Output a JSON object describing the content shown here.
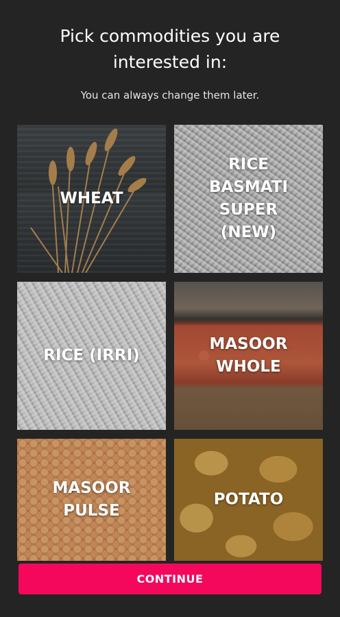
{
  "header": {
    "title": "Pick commodities you are interested in:",
    "subtitle": "You can always change them later."
  },
  "commodities": [
    {
      "label": "WHEAT"
    },
    {
      "label": "RICE\nBASMATI\nSUPER\n(NEW)"
    },
    {
      "label": "RICE (IRRI)"
    },
    {
      "label": "MASOOR\nWHOLE"
    },
    {
      "label": "MASOOR\nPULSE"
    },
    {
      "label": "POTATO"
    }
  ],
  "footer": {
    "continue_label": "CONTINUE"
  },
  "colors": {
    "background": "#242424",
    "accent": "#f4085c",
    "text": "#ffffff"
  }
}
